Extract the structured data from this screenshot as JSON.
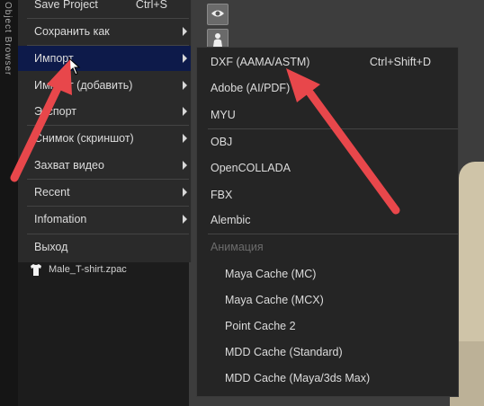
{
  "colors": {
    "menu_bg": "#2a2a2a",
    "submenu_bg": "#252525",
    "active_item_bg": "#0d1a4a",
    "text": "#dcdcdc",
    "disabled_text": "#6c6c6c",
    "annotation_arrow": "#e8474b"
  },
  "sidebar": {
    "vertical_label": "Object Browser"
  },
  "file_browser": {
    "item_label": "Male_T-shirt.zpac",
    "item_icon": "tshirt-icon"
  },
  "menu": {
    "items": [
      {
        "label": "Save Project",
        "shortcut": "Ctrl+S"
      },
      {
        "label": "Сохранить как"
      },
      {
        "label": "Импорт"
      },
      {
        "label": "Импорт (добавить)"
      },
      {
        "label": "Экспорт"
      },
      {
        "label": "Снимок (скриншот)"
      },
      {
        "label": "Захват видео"
      },
      {
        "label": "Recent"
      },
      {
        "label": "Infomation"
      },
      {
        "label": "Выход"
      }
    ]
  },
  "submenu": {
    "items": [
      {
        "label": "DXF (AAMA/ASTM)",
        "shortcut": "Ctrl+Shift+D"
      },
      {
        "label": "Adobe (AI/PDF)"
      },
      {
        "label": "MYU"
      },
      {
        "label": "OBJ"
      },
      {
        "label": "OpenCOLLADA"
      },
      {
        "label": "FBX"
      },
      {
        "label": "Alembic"
      },
      {
        "label": "Анимация"
      },
      {
        "label": "Maya Cache (MC)"
      },
      {
        "label": "Maya Cache (MCX)"
      },
      {
        "label": "Point Cache 2"
      },
      {
        "label": "MDD Cache (Standard)"
      },
      {
        "label": "MDD Cache (Maya/3ds Max)"
      }
    ]
  },
  "viewport": {
    "buttons": [
      "eye-icon",
      "avatar-icon"
    ]
  }
}
